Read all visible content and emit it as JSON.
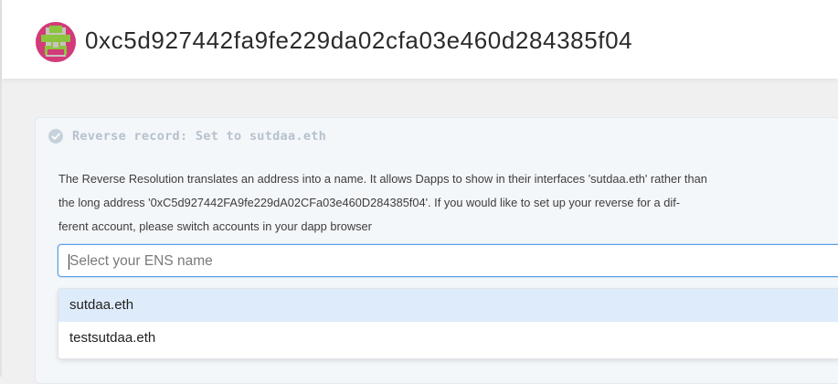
{
  "header": {
    "address": "0xc5d927442fa9fe229da02cfa03e460d284385f04",
    "avatar_icon": "identicon-avatar"
  },
  "reverse_record": {
    "title": "Reverse record: Set to sutdaa.eth",
    "status_icon": "check-circle-icon",
    "description_lines": [
      "The Reverse Resolution translates an address into a name. It allows Dapps to show in their interfaces 'sutdaa.eth' rather than",
      "the long address '0xC5d927442FA9fe229dA02CFa03e460D284385f04'. If you would like to set up your reverse for a dif-",
      "ferent account, please switch accounts in your dapp browser"
    ],
    "select": {
      "placeholder": "Select your ENS name",
      "value": ""
    },
    "options": [
      "sutdaa.eth",
      "testsutdaa.eth"
    ],
    "focused_option": "sutdaa.eth"
  },
  "colors": {
    "focus_border": "#5aa0e8",
    "option_highlight": "#deebfb",
    "avatar_bg": "#c8c2bf",
    "avatar_pink": "#d23a79",
    "avatar_green": "#8cc43d"
  }
}
